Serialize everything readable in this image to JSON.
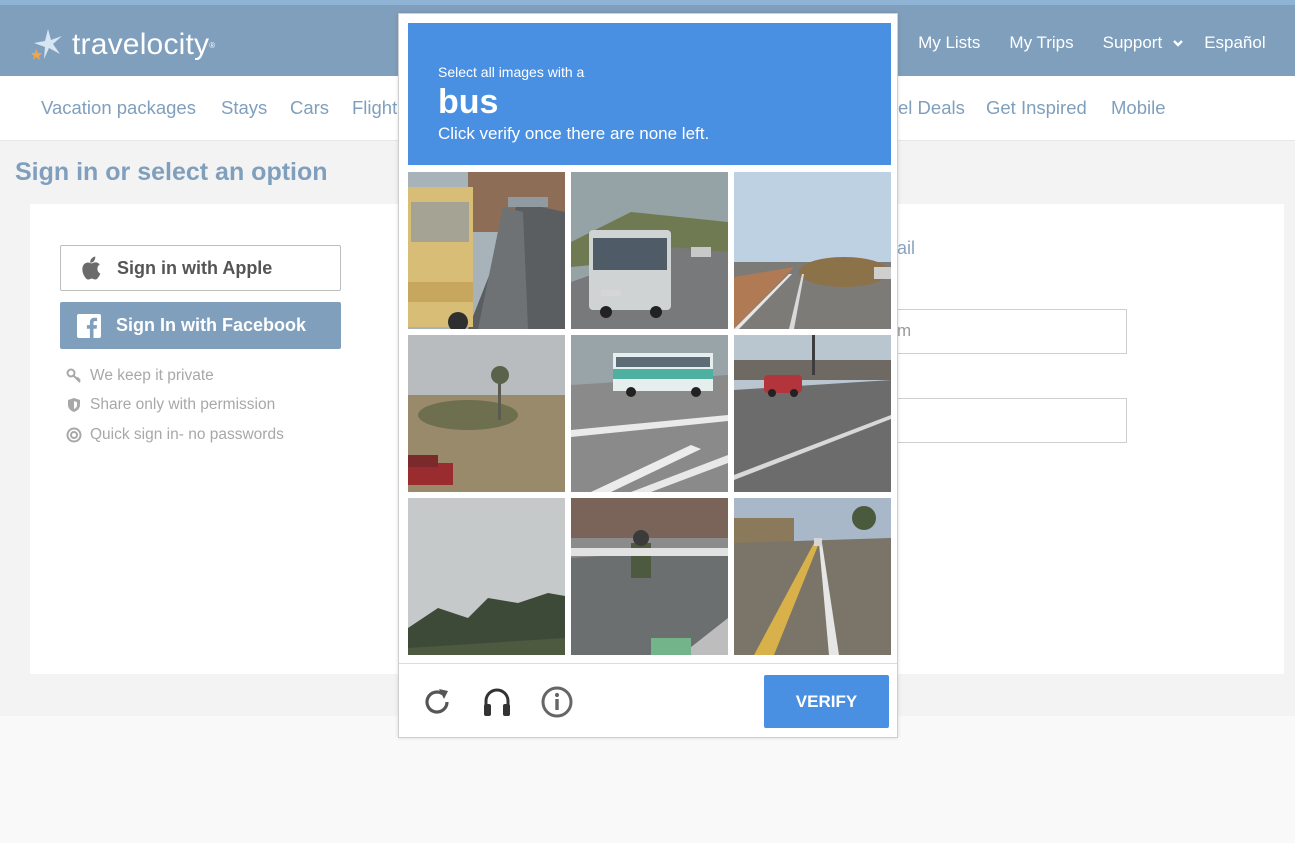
{
  "brand": {
    "name": "travelocity",
    "reg": "®"
  },
  "top_nav": [
    {
      "label": "My Lists"
    },
    {
      "label": "My Trips"
    },
    {
      "label": "Support"
    },
    {
      "label": "Español"
    }
  ],
  "subnav": [
    "Vacation packages",
    "Stays",
    "Cars",
    "Flight",
    "el Deals",
    "Get Inspired",
    "Mobile"
  ],
  "page": {
    "title": "Sign in or select an option",
    "apple_label": "Sign in with Apple",
    "facebook_label": "Sign In with Facebook",
    "perks": [
      "We keep it private",
      "Share only with permission",
      "Quick sign in- no passwords"
    ],
    "email_label_fragment": "ail",
    "email_placeholder_fragment": "m"
  },
  "captcha": {
    "line1": "Select all images with a",
    "target": "bus",
    "line3": "Click verify once there are none left.",
    "verify_label": "VERIFY",
    "icons": [
      "reload-icon",
      "audio-icon",
      "info-icon"
    ]
  },
  "colors": {
    "header": "#7f9fbd",
    "captcha_blue": "#4a90e2"
  }
}
